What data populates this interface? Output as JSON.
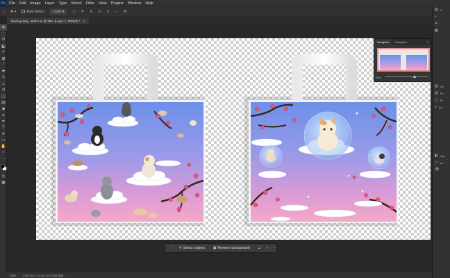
{
  "app": {
    "logo": "Ps",
    "menu": [
      "File",
      "Edit",
      "Image",
      "Layer",
      "Type",
      "Select",
      "Filter",
      "View",
      "Plugins",
      "Window",
      "Help"
    ]
  },
  "options": {
    "auto_select_label": "Auto-Select",
    "auto_select_target": "Layer"
  },
  "document": {
    "tab_title": "Mockup Bag - Edit 1.ai @ 25% (Layer 1, RGB/8) *"
  },
  "navigator": {
    "tabs": [
      "Navigator",
      "Histogram"
    ],
    "zoom": "25%"
  },
  "status": {
    "zoom": "25%",
    "info": "14.8 cm x 11.81 cm (180 ppi)"
  },
  "context_bar": {
    "select_subject": "Select subject",
    "remove_background": "Remove background"
  },
  "right_panel": {
    "labels": [
      "Li",
      "Lib",
      "Pa",
      "Pr",
      "Ad",
      "Lay",
      "La"
    ]
  },
  "colors": {
    "accent": "#31a8ff",
    "panel": "#323232",
    "workspace": "#282828",
    "bag_gradient_top": "#7b9ce8",
    "bag_gradient_bottom": "#f2a4cc"
  }
}
